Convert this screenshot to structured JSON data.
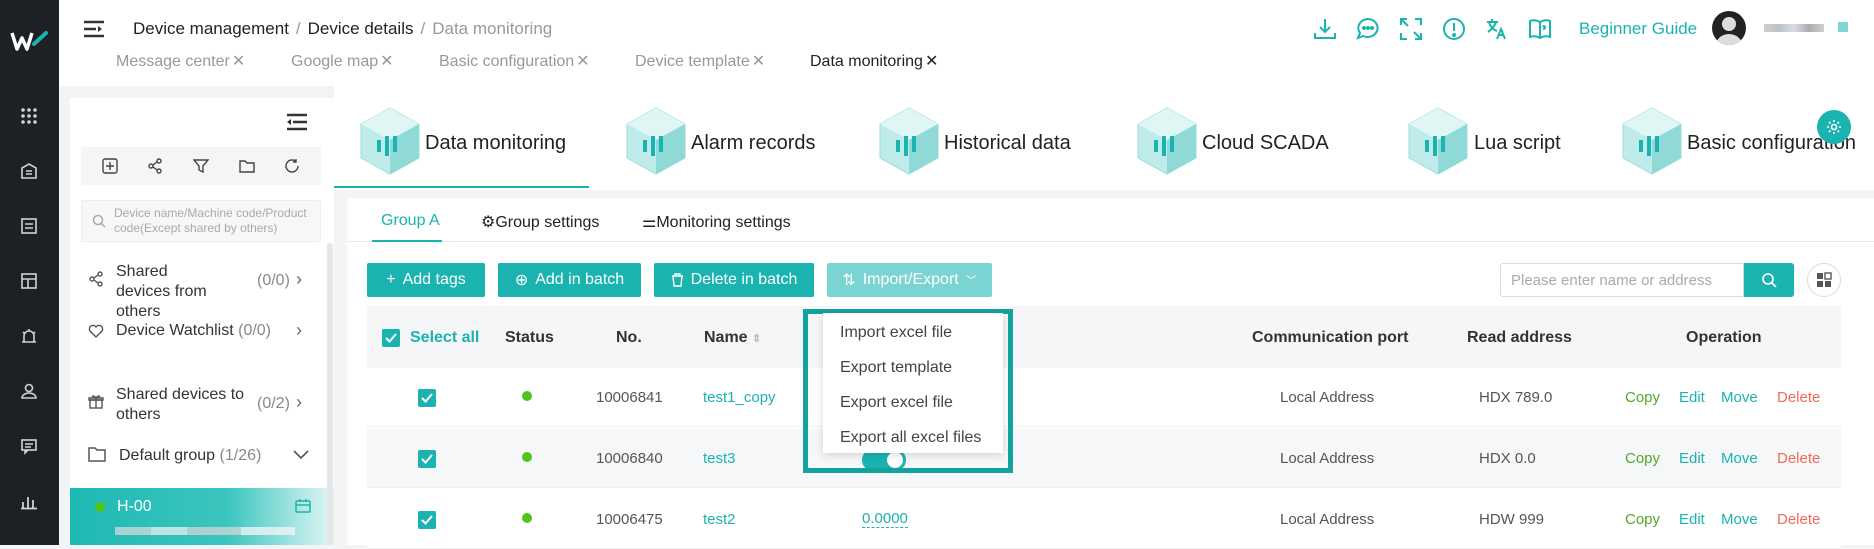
{
  "breadcrumb": {
    "items": [
      "Device management",
      "Device details",
      "Data monitoring"
    ]
  },
  "open_tabs": [
    {
      "label": "Message center",
      "active": false
    },
    {
      "label": "Google map",
      "active": false
    },
    {
      "label": "Basic configuration",
      "active": false
    },
    {
      "label": "Device template",
      "active": false
    },
    {
      "label": "Data monitoring",
      "active": true
    }
  ],
  "header": {
    "icons": [
      "download-icon",
      "chat-icon",
      "fullscreen-icon",
      "info-icon",
      "translate-icon",
      "book-icon"
    ],
    "guide_label": "Beginner Guide"
  },
  "rail_icons": [
    "apps-icon",
    "building-icon",
    "list-icon",
    "dashboard-icon",
    "alarm-icon",
    "user-icon",
    "message-icon",
    "chart-icon"
  ],
  "left_panel": {
    "toolbar_icons": [
      "add-square-icon",
      "share-icon",
      "filter-icon",
      "folder-icon",
      "refresh-icon"
    ],
    "search_placeholder": "Device name/Machine code/Product code(Except shared by others)",
    "shared_from_label": "Shared devices from others",
    "shared_from_count": "(0/0)",
    "watchlist_label": "Device Watchlist",
    "watchlist_count": "(0/0)",
    "shared_to_label": "Shared devices to others",
    "shared_to_count": "(0/2)",
    "group_label": "Default group",
    "group_count": "(1/26)",
    "selected_device": "H-00"
  },
  "function_tabs": [
    {
      "label": "Data monitoring",
      "active": true
    },
    {
      "label": "Alarm records",
      "active": false
    },
    {
      "label": "Historical data",
      "active": false
    },
    {
      "label": "Cloud SCADA",
      "active": false
    },
    {
      "label": "Lua script",
      "active": false
    },
    {
      "label": "Basic configuration",
      "active": false
    }
  ],
  "sub_tabs": {
    "group_a": "Group A",
    "group_settings": "Group settings",
    "monitoring_settings": "Monitoring settings"
  },
  "actions": {
    "add_tags": "Add tags",
    "add_in_batch": "Add in batch",
    "delete_in_batch": "Delete in batch",
    "import_export": "Import/Export"
  },
  "search": {
    "placeholder": "Please enter name or address"
  },
  "dropdown": {
    "items": [
      "Import excel file",
      "Export template",
      "Export excel file",
      "Export all excel files"
    ]
  },
  "table": {
    "headers": {
      "select_all": "Select all",
      "status": "Status",
      "no": "No.",
      "name": "Name",
      "port": "Communication port",
      "address": "Read address",
      "operation": "Operation"
    },
    "rows": [
      {
        "no": "10006841",
        "name": "test1_copy",
        "value": "",
        "port": "Local Address",
        "address": "HDX 789.0"
      },
      {
        "no": "10006840",
        "name": "test3",
        "value": "",
        "port": "Local Address",
        "address": "HDX 0.0"
      },
      {
        "no": "10006475",
        "name": "test2",
        "value": "0.0000",
        "port": "Local Address",
        "address": "HDW 999"
      }
    ],
    "ops": {
      "copy": "Copy",
      "edit": "Edit",
      "move": "Move",
      "delete": "Delete"
    }
  },
  "colors": {
    "accent": "#1bb3b0",
    "rail": "#1d2125",
    "status_online": "#52c41a",
    "delete": "#ef6b5b",
    "copy": "#52a829"
  }
}
